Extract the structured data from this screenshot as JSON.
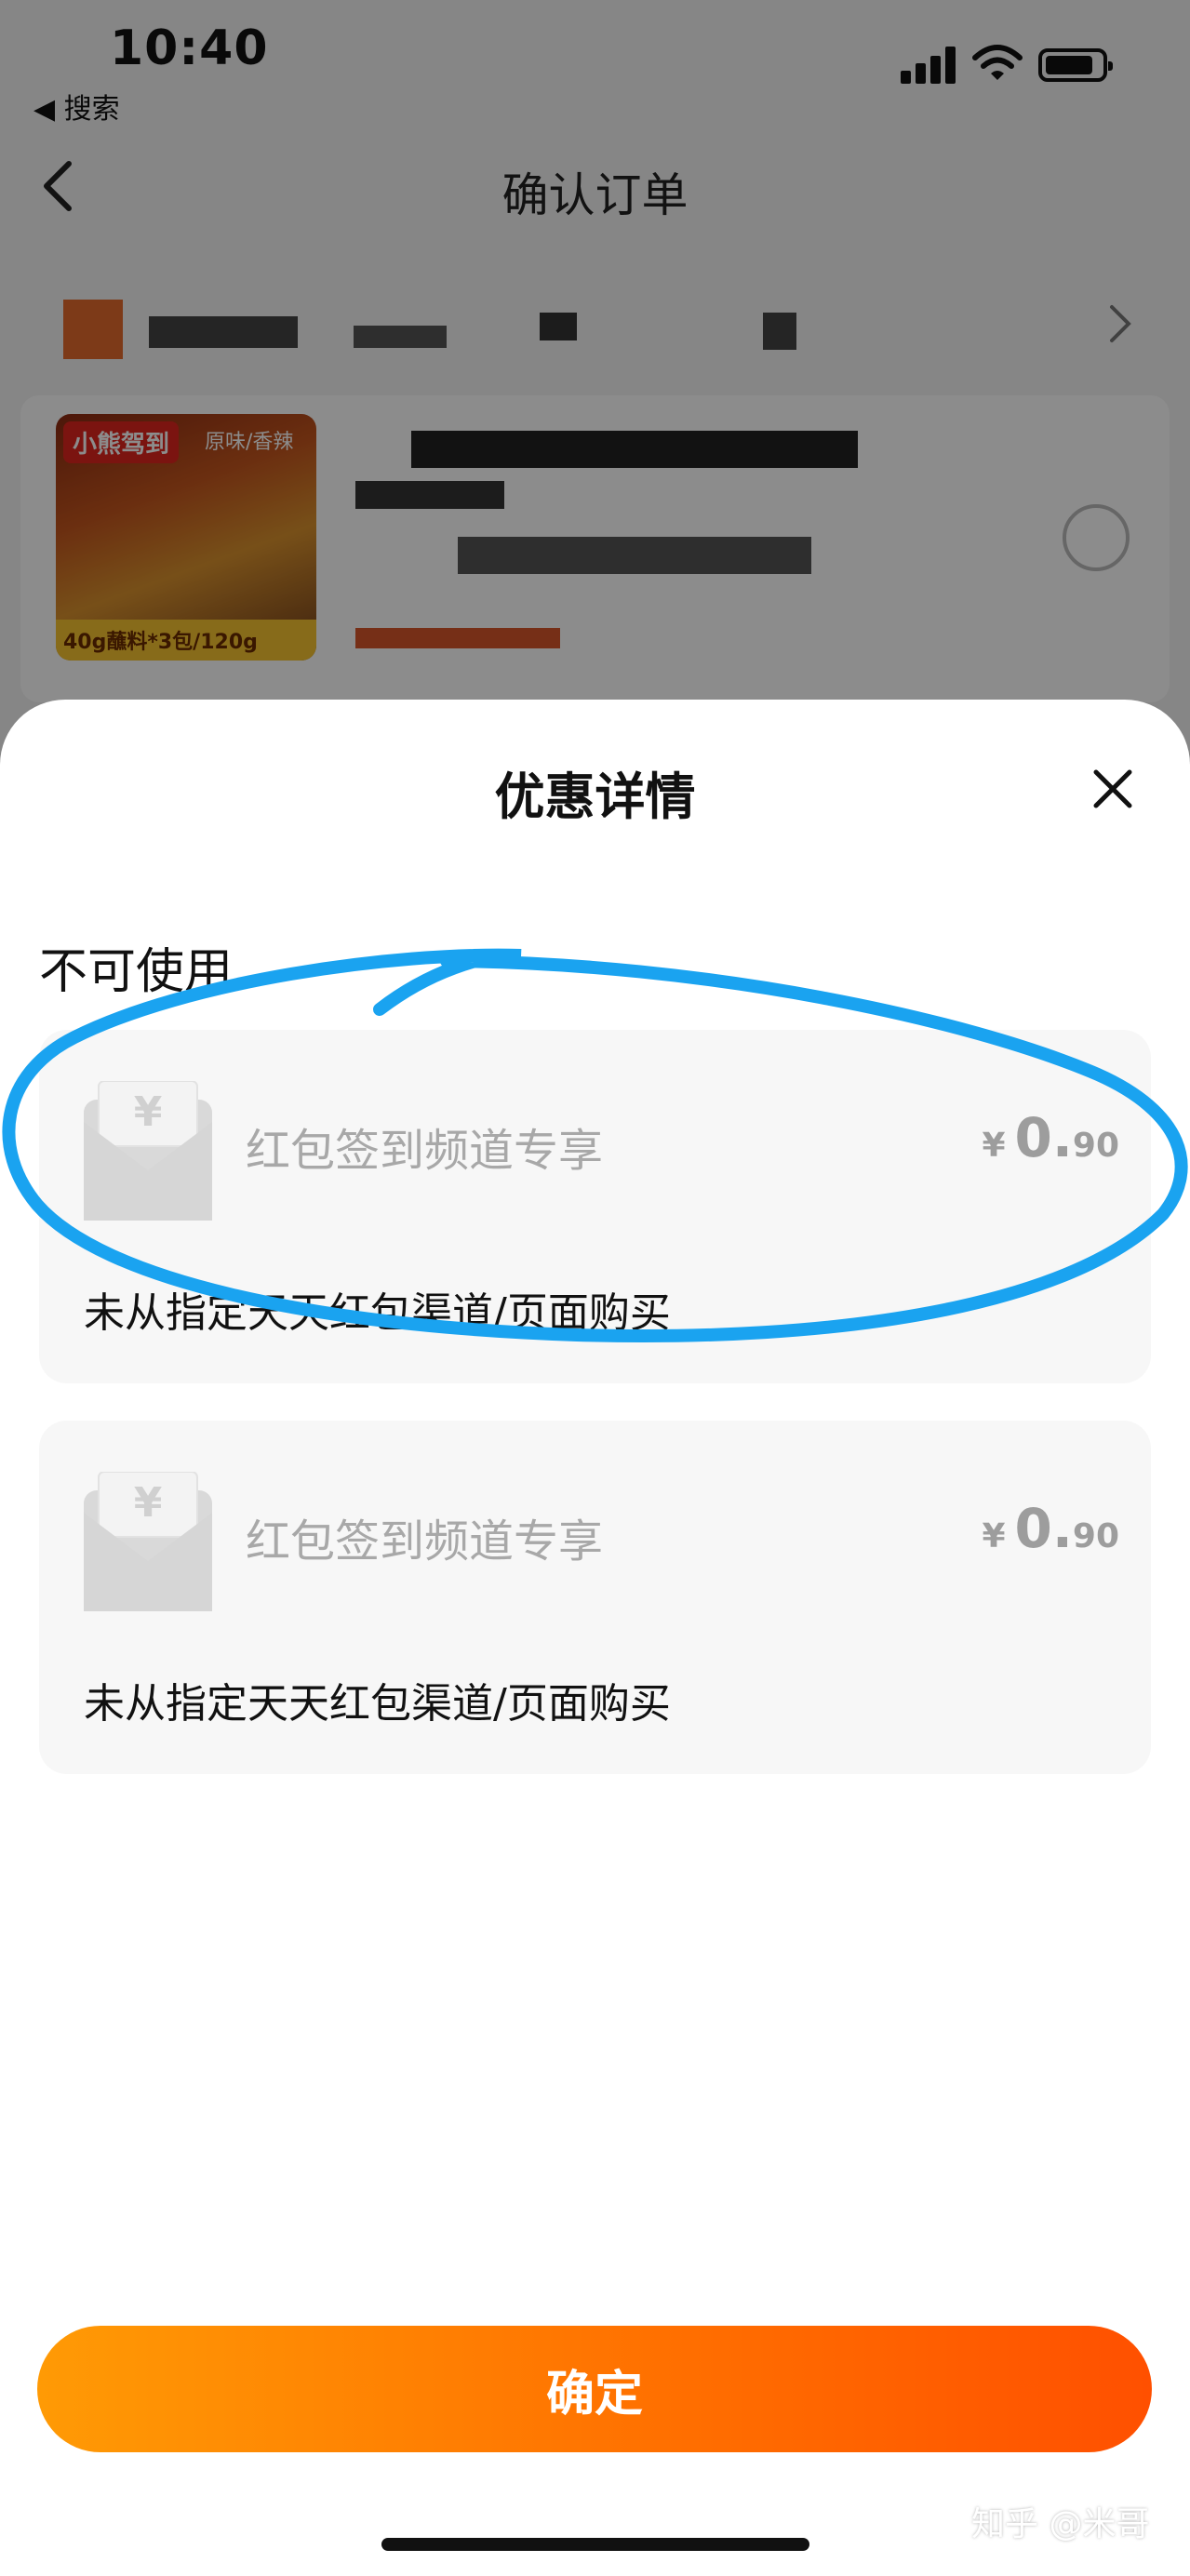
{
  "status_bar": {
    "time": "10:40",
    "back_label": "◀ 搜索"
  },
  "nav": {
    "title": "确认订单"
  },
  "product": {
    "brand": "小熊驾到",
    "flavor": "原味/香辣",
    "note": "40g蘸料*3包/120g"
  },
  "sheet": {
    "title": "优惠详情",
    "section_title": "不可使用",
    "coupons": [
      {
        "name": "红包签到频道专享",
        "currency": "¥",
        "price_int": "0.",
        "price_dec": "90",
        "reason": "未从指定天天红包渠道/页面购买",
        "icon": "red-envelope-icon"
      },
      {
        "name": "红包签到频道专享",
        "currency": "¥",
        "price_int": "0.",
        "price_dec": "90",
        "reason": "未从指定天天红包渠道/页面购买",
        "icon": "red-envelope-icon"
      }
    ],
    "confirm_label": "确定"
  },
  "watermark": "知乎 @米哥",
  "colors": {
    "accent_start": "#ff9a05",
    "accent_end": "#ff5000",
    "highlight": "#1aa3f0",
    "disabled_text": "#a8a8a8"
  }
}
